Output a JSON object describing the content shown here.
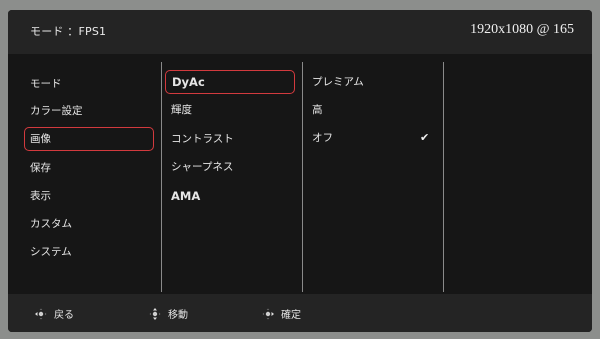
{
  "header": {
    "title": "モード ：FPS1",
    "resolution": "1920x1080 @ 165"
  },
  "menu": {
    "main": [
      {
        "label": "モード"
      },
      {
        "label": "カラー設定"
      },
      {
        "label": "画像",
        "selected": true
      },
      {
        "label": "保存"
      },
      {
        "label": "表示"
      },
      {
        "label": "カスタム"
      },
      {
        "label": "システム"
      }
    ],
    "sub": [
      {
        "label": "DyAc",
        "selected": true
      },
      {
        "label": "輝度"
      },
      {
        "label": "コントラスト"
      },
      {
        "label": "シャープネス"
      },
      {
        "label": "AMA"
      }
    ],
    "options": [
      {
        "label": "プレミアム"
      },
      {
        "label": "高"
      },
      {
        "label": "オフ",
        "checked": true
      }
    ],
    "check_mark": "✔"
  },
  "footer": {
    "back_label": "戻る",
    "move_label": "移動",
    "confirm_label": "確定"
  },
  "colors": {
    "accent": "#d23a3e",
    "panel": "#161616",
    "bar": "#242424"
  }
}
